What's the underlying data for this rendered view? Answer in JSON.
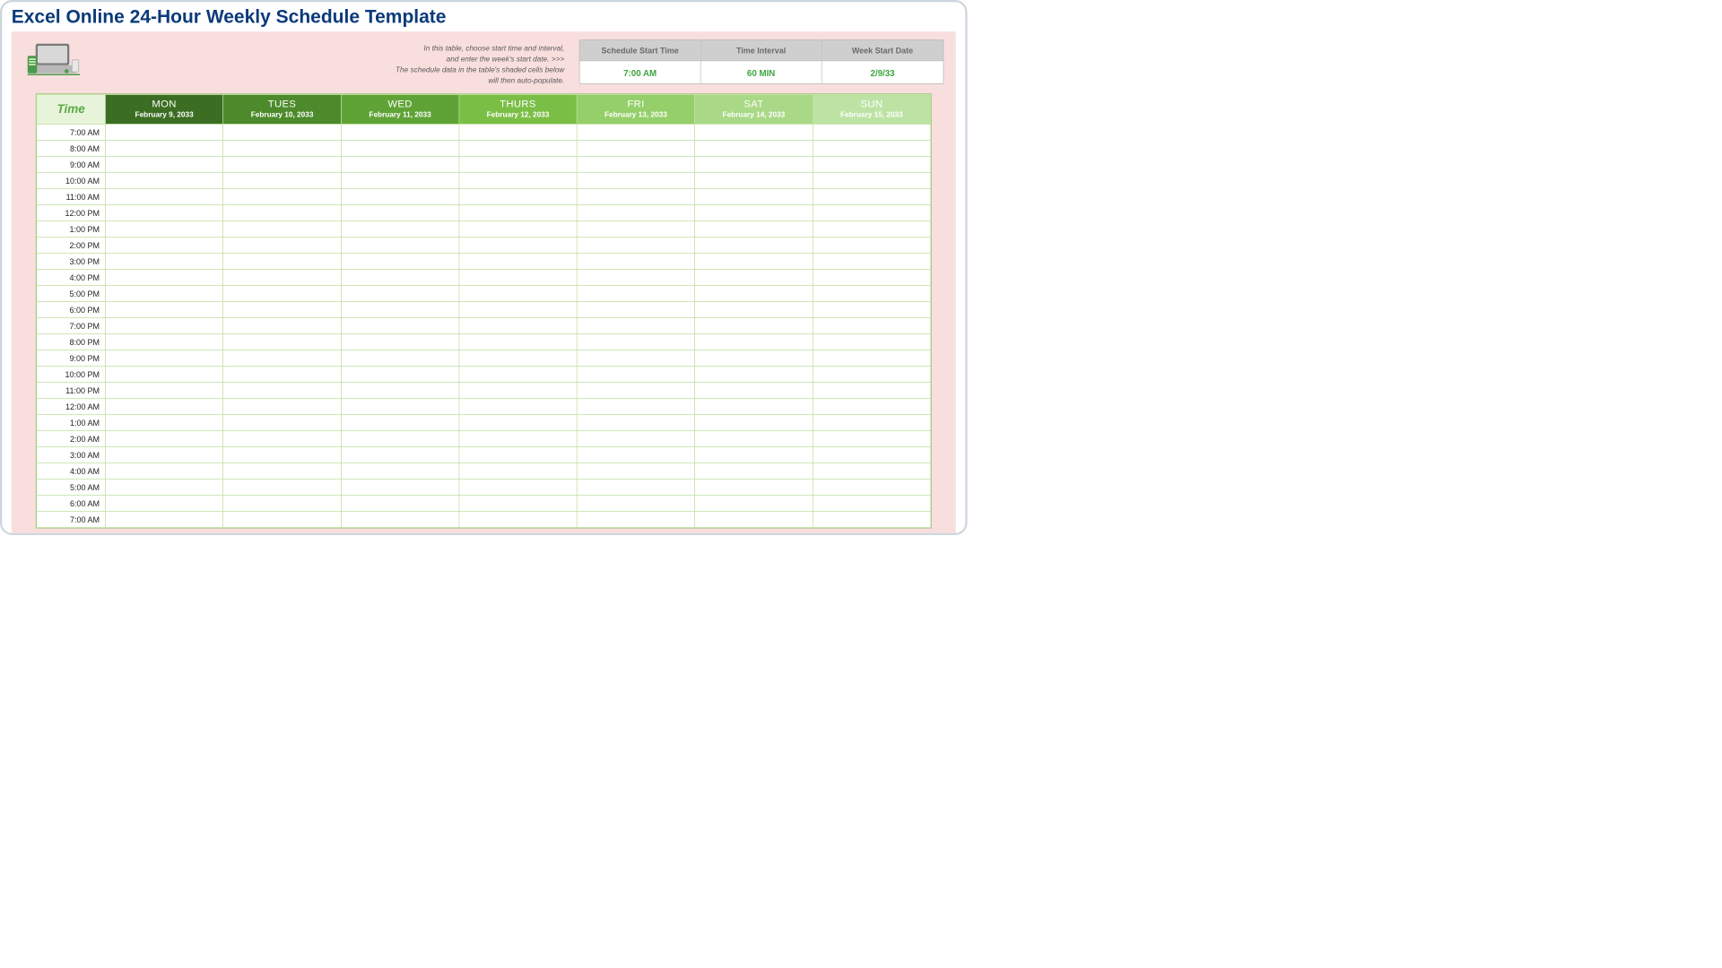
{
  "title": "Excel Online 24-Hour Weekly Schedule Template",
  "instructions": {
    "line1": "In this table, choose start time and interval,",
    "line2": "and enter the week's start date. >>>",
    "line3": "The schedule data in the table's shaded cells below",
    "line4": "will then auto-populate."
  },
  "config": {
    "startTime": {
      "label": "Schedule Start Time",
      "value": "7:00 AM"
    },
    "interval": {
      "label": "Time Interval",
      "value": "60 MIN"
    },
    "weekStart": {
      "label": "Week Start Date",
      "value": "2/9/33"
    }
  },
  "grid": {
    "timeHeader": "Time",
    "days": [
      {
        "name": "MON",
        "date": "February 9, 2033"
      },
      {
        "name": "TUES",
        "date": "February 10, 2033"
      },
      {
        "name": "WED",
        "date": "February 11, 2033"
      },
      {
        "name": "THURS",
        "date": "February 12, 2033"
      },
      {
        "name": "FRI",
        "date": "February 13, 2033"
      },
      {
        "name": "SAT",
        "date": "February 14, 2033"
      },
      {
        "name": "SUN",
        "date": "February 15, 2033"
      }
    ],
    "times": [
      "7:00 AM",
      "8:00 AM",
      "9:00 AM",
      "10:00 AM",
      "11:00 AM",
      "12:00 PM",
      "1:00 PM",
      "2:00 PM",
      "3:00 PM",
      "4:00 PM",
      "5:00 PM",
      "6:00 PM",
      "7:00 PM",
      "8:00 PM",
      "9:00 PM",
      "10:00 PM",
      "11:00 PM",
      "12:00 AM",
      "1:00 AM",
      "2:00 AM",
      "3:00 AM",
      "4:00 AM",
      "5:00 AM",
      "6:00 AM",
      "7:00 AM"
    ]
  }
}
